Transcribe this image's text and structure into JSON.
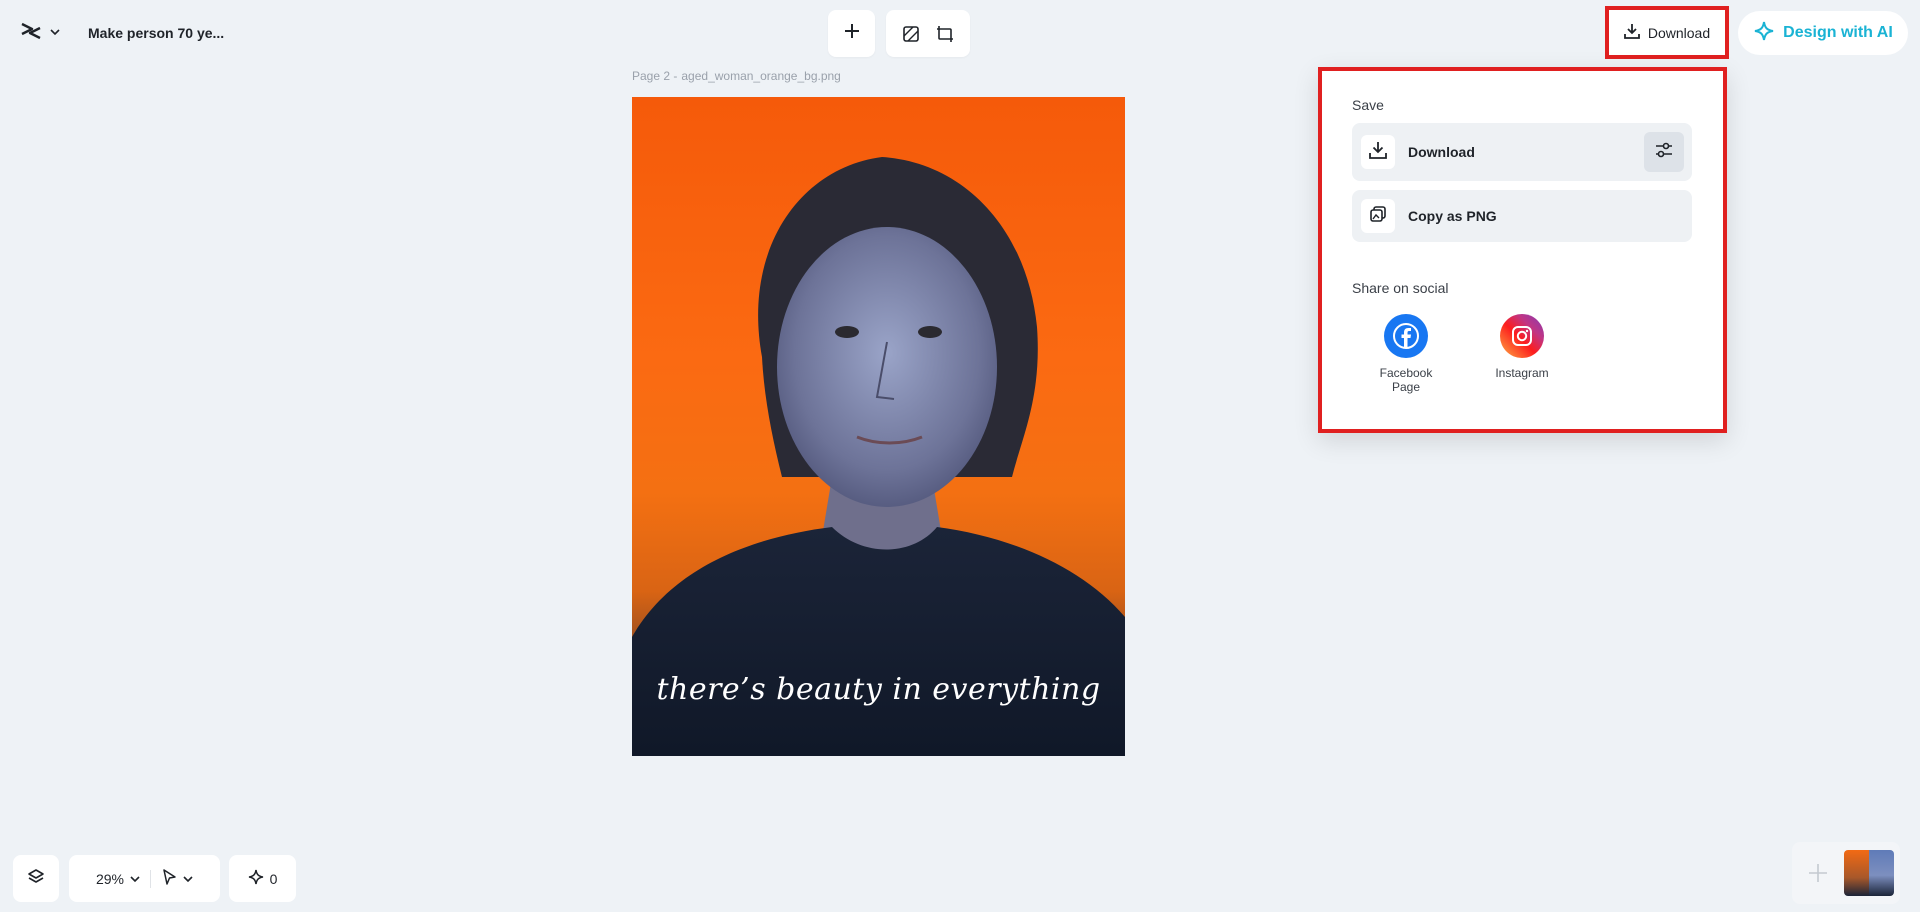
{
  "header": {
    "doc_title": "Make person 70 ye...",
    "download_label": "Download",
    "design_ai_label": "Design with AI"
  },
  "canvas": {
    "page_label": "Page 2 -",
    "file_name": "aged_woman_orange_bg.png",
    "quote": "there’s beauty in everything"
  },
  "panel": {
    "save_title": "Save",
    "download_label": "Download",
    "copy_label": "Copy as PNG",
    "share_title": "Share on social",
    "socials": [
      {
        "label_line1": "Facebook",
        "label_line2": "Page",
        "icon": "facebook-icon",
        "color": "#1877f2"
      },
      {
        "label_line1": "Instagram",
        "label_line2": "",
        "icon": "instagram-icon",
        "color": "#d6249f"
      }
    ]
  },
  "footer": {
    "zoom": "29%",
    "ai_count": "0"
  },
  "colors": {
    "accent": "#1ab3d4",
    "highlight": "#e02020",
    "background": "#eef2f6"
  }
}
